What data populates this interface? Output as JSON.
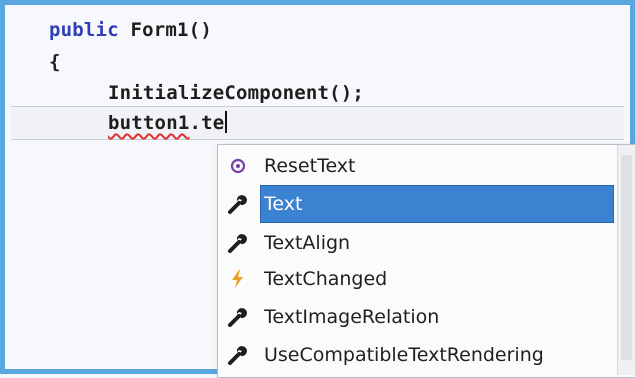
{
  "code": {
    "line1": {
      "keyword": "public",
      "rest": " Form1()"
    },
    "line2": "{",
    "line3": "InitializeComponent();",
    "line4": {
      "word": "button1",
      "rest": ".te"
    }
  },
  "completion": {
    "items": [
      {
        "label": "ResetText",
        "icon": "method-icon",
        "selected": false
      },
      {
        "label": "Text",
        "icon": "wrench-icon",
        "selected": true
      },
      {
        "label": "TextAlign",
        "icon": "wrench-icon",
        "selected": false
      },
      {
        "label": "TextChanged",
        "icon": "lightning-icon",
        "selected": false
      },
      {
        "label": "TextImageRelation",
        "icon": "wrench-icon",
        "selected": false
      },
      {
        "label": "UseCompatibleTextRendering",
        "icon": "wrench-icon",
        "selected": false
      }
    ]
  },
  "colors": {
    "frame_border": "#5aa6de",
    "keyword": "#2f3fb4",
    "selection": "#3b82d1",
    "squiggle": "#e03030",
    "method_icon": "#7b3fa8",
    "event_icon": "#f0a020"
  }
}
